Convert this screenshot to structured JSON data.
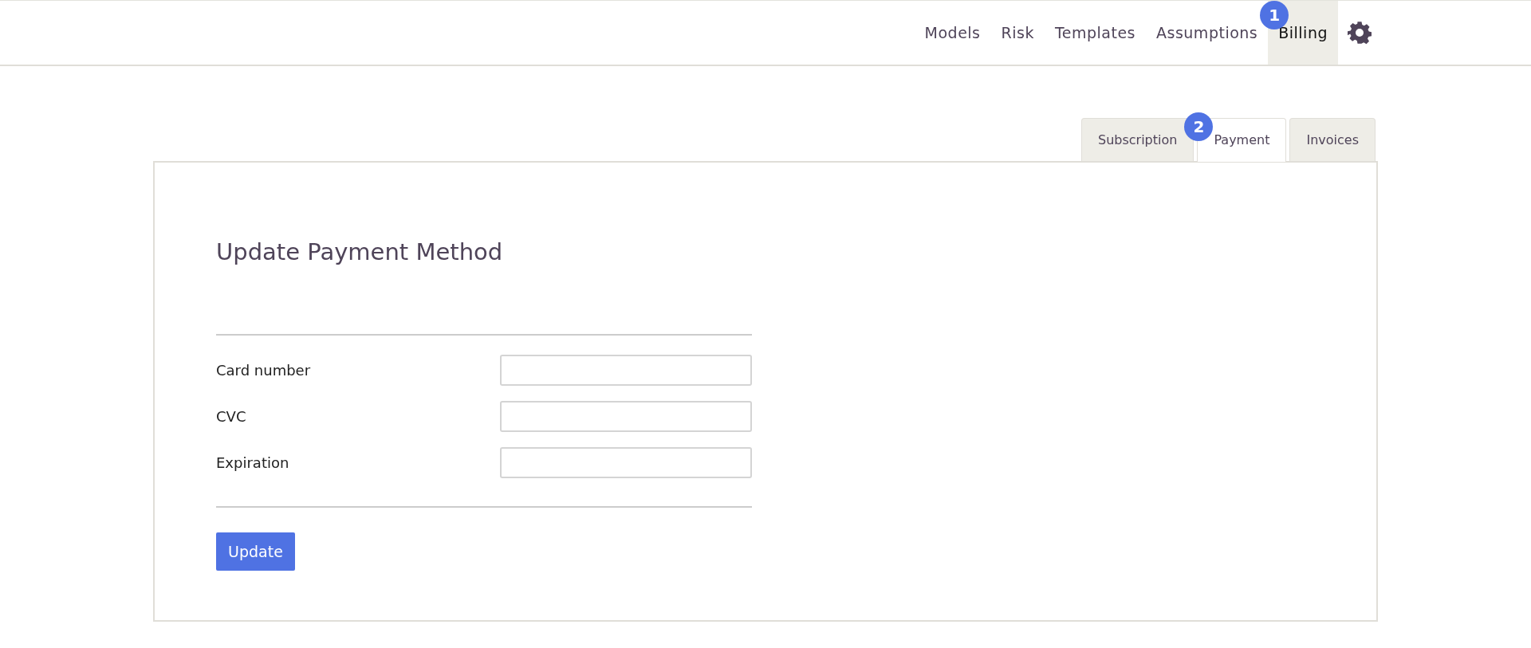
{
  "nav": {
    "items": [
      {
        "label": "Models",
        "selected": false
      },
      {
        "label": "Risk",
        "selected": false
      },
      {
        "label": "Templates",
        "selected": false
      },
      {
        "label": "Assumptions",
        "selected": false
      },
      {
        "label": "Billing",
        "selected": true,
        "badge": "1"
      }
    ]
  },
  "tabs": [
    {
      "label": "Subscription",
      "selected": false
    },
    {
      "label": "Payment",
      "selected": true,
      "badge": "2"
    },
    {
      "label": "Invoices",
      "selected": false
    }
  ],
  "form": {
    "title": "Update Payment Method",
    "fields": [
      {
        "label": "Card number"
      },
      {
        "label": "CVC"
      },
      {
        "label": "Expiration"
      }
    ],
    "button": "Update"
  }
}
